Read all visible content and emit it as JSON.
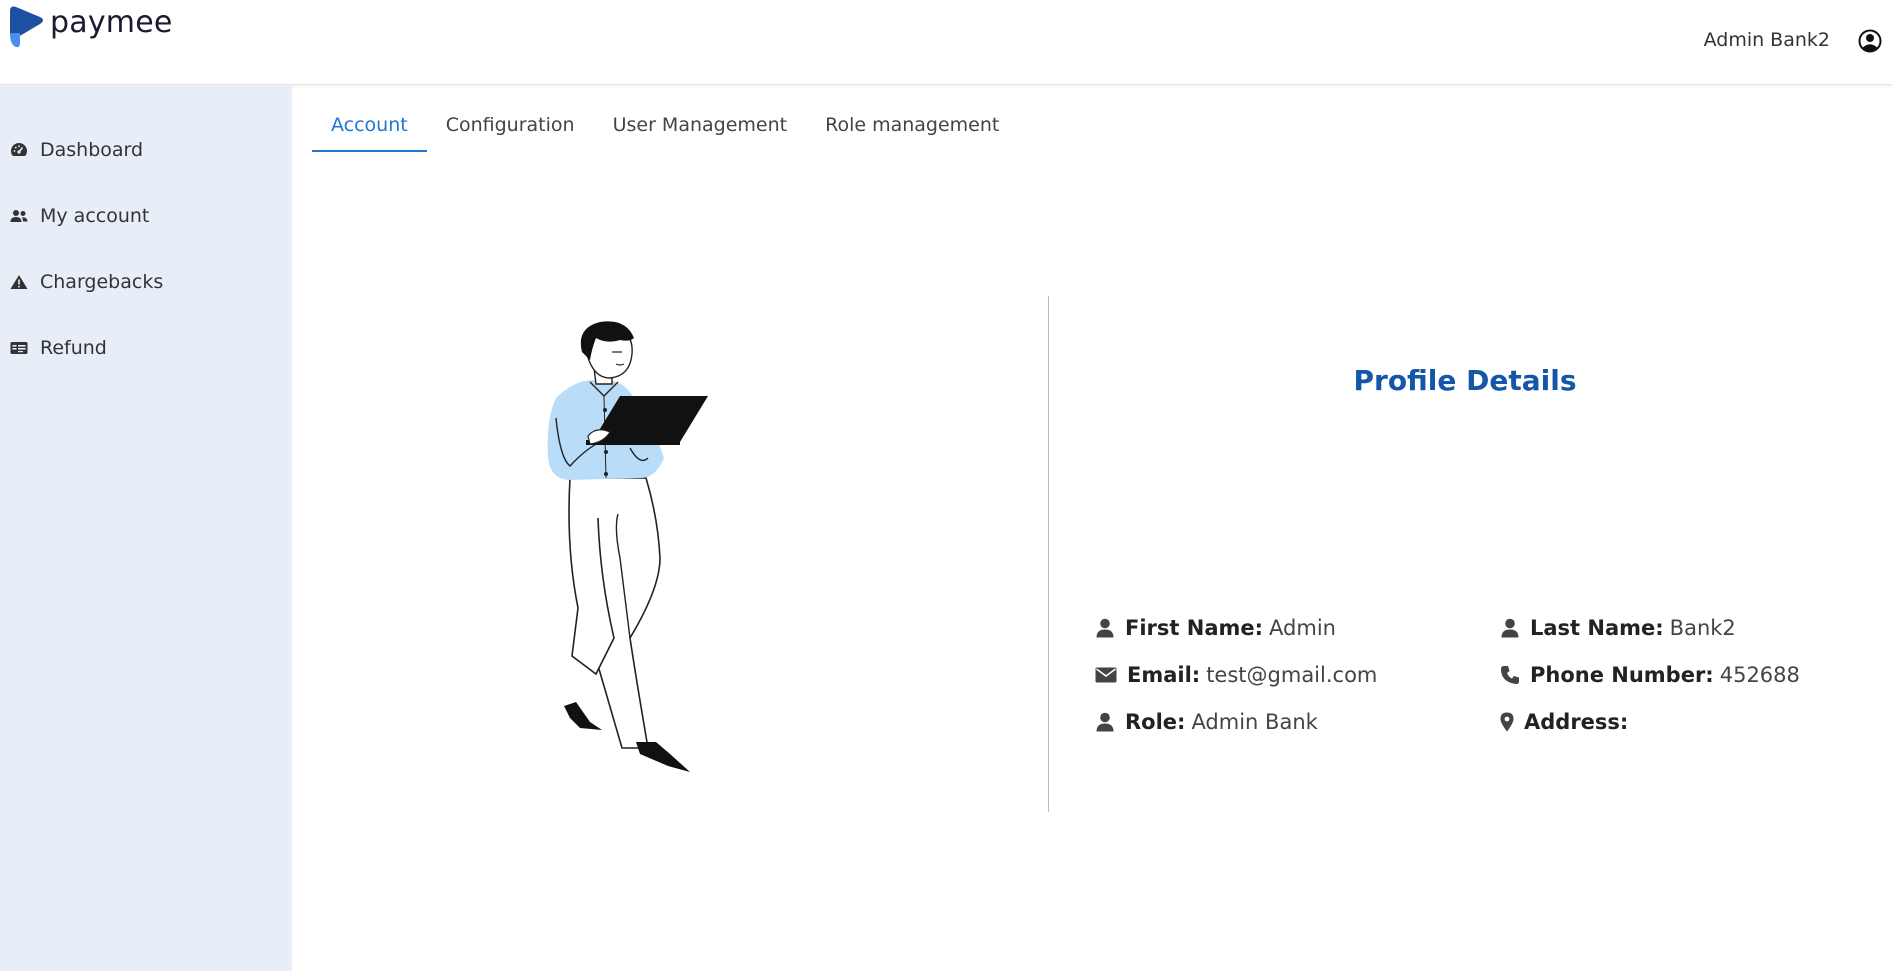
{
  "brand": {
    "name": "paymee",
    "colors": {
      "primary": "#1f77d4",
      "title": "#1456a8",
      "sidebar": "#e8eef8"
    }
  },
  "header": {
    "user_name": "Admin Bank2",
    "user_icon": "user-circle-icon"
  },
  "sidebar": {
    "items": [
      {
        "label": "Dashboard",
        "icon": "speedometer-icon"
      },
      {
        "label": "My account",
        "icon": "users-icon"
      },
      {
        "label": "Chargebacks",
        "icon": "warning-icon"
      },
      {
        "label": "Refund",
        "icon": "id-card-icon"
      }
    ]
  },
  "tabs": [
    {
      "label": "Account",
      "active": true
    },
    {
      "label": "Configuration",
      "active": false
    },
    {
      "label": "User Management",
      "active": false
    },
    {
      "label": "Role management",
      "active": false
    }
  ],
  "profile": {
    "title": "Profile Details",
    "fields": {
      "first_name": {
        "label": "First Name:",
        "value": "Admin",
        "icon": "user-icon"
      },
      "last_name": {
        "label": "Last Name:",
        "value": "Bank2",
        "icon": "user-icon"
      },
      "email": {
        "label": "Email:",
        "value": "test@gmail.com",
        "icon": "envelope-icon"
      },
      "phone": {
        "label": "Phone Number:",
        "value": "452688",
        "icon": "phone-icon"
      },
      "role": {
        "label": "Role:",
        "value": "Admin Bank",
        "icon": "user-icon"
      },
      "address": {
        "label": "Address:",
        "value": "",
        "icon": "map-pin-icon"
      }
    }
  }
}
